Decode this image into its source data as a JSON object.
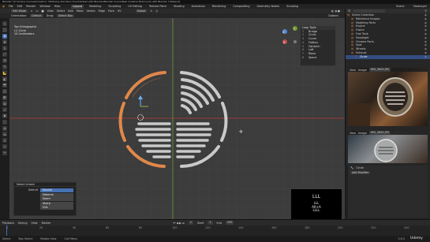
{
  "window_title": "Blender* [D:\\Online Courses\\Creators' 3D\\Harley-Davidson Knucklehead with Blender\\Blender Scene\\Real Creative Motorcycle with Blender 3.6\\blend]",
  "menu": [
    "File",
    "Edit",
    "Render",
    "Window",
    "Help"
  ],
  "workspace_tabs": [
    "Layout",
    "Modeling",
    "Sculpting",
    "UV Editing",
    "Texture Paint",
    "Shading",
    "Animation",
    "Rendering",
    "Compositing",
    "Geometry Nodes",
    "Scripting"
  ],
  "active_tab": "Layout",
  "scene_label": "Scene",
  "view_layer_label": "ViewLayer",
  "header": {
    "mode": "Edit Mode",
    "menus": [
      "View",
      "Select",
      "Add",
      "Mesh",
      "Vertex",
      "Edge",
      "Face",
      "UV"
    ],
    "transform": "Global",
    "orientation_label": "Orientation:",
    "orientation_value": "Default",
    "drag_label": "Drag:",
    "drag_value": "Select Box",
    "options_label": "Options"
  },
  "viewport_info": {
    "line1": "Top Orthographic",
    "line2": "(1) Circle",
    "line3": "10 Centimeters"
  },
  "last_operator": {
    "title": "Select Linked",
    "delimit_label": "Delimit",
    "options": [
      "Normal",
      "Material",
      "Seam",
      "Sharp",
      "UVs"
    ],
    "selected": "Normal"
  },
  "view_list": {
    "title": "Loop Tools",
    "rows": [
      {
        "n": "1",
        "l": "Bridge"
      },
      {
        "n": "2",
        "l": "Circle"
      },
      {
        "n": "3",
        "l": "Curve"
      },
      {
        "n": "4",
        "l": "Flatten"
      },
      {
        "n": "5",
        "l": "Gstretch"
      },
      {
        "n": "6",
        "l": "Loft"
      },
      {
        "n": "7",
        "l": "Relax"
      },
      {
        "n": "8",
        "l": "Space"
      }
    ]
  },
  "shortcut_overlay": {
    "big": "LLL",
    "line1": "LLL",
    "line2": "Alt+A",
    "line3": "LLLL"
  },
  "outliner": {
    "search_placeholder": "",
    "items": [
      {
        "label": "Scene Collection",
        "indent": 0,
        "sel": false
      },
      {
        "label": "Reference Images",
        "indent": 1,
        "sel": false
      },
      {
        "label": "Modeling Parts",
        "indent": 1,
        "sel": false
      },
      {
        "label": "Engine",
        "indent": 1,
        "sel": false
      },
      {
        "label": "Frame",
        "indent": 1,
        "sel": false
      },
      {
        "label": "Fuel Tank",
        "indent": 1,
        "sel": false
      },
      {
        "label": "Headlight",
        "indent": 1,
        "sel": false
      },
      {
        "label": "Chrome Parts",
        "indent": 1,
        "sel": false
      },
      {
        "label": "Seat",
        "indent": 1,
        "sel": false
      },
      {
        "label": "Wheels",
        "indent": 1,
        "sel": false
      },
      {
        "label": "Exhaust",
        "indent": 1,
        "sel": false
      },
      {
        "label": "Circle",
        "indent": 2,
        "sel": true
      }
    ]
  },
  "image_editors": [
    {
      "view": "View",
      "image": "Image",
      "name": "IMG_3843.JPG"
    },
    {
      "view": "View",
      "image": "Image",
      "name": "IMG_3845.JPG"
    }
  ],
  "properties": {
    "object_name": "Circle",
    "modifier_label": "Add Modifier"
  },
  "timeline": {
    "menus": [
      "Playback",
      "Keying",
      "View",
      "Marker"
    ],
    "current_frame": "1",
    "start_label": "Start",
    "start": "1",
    "end_label": "End",
    "end": "250",
    "ticks": [
      "0",
      "20",
      "40",
      "60",
      "80",
      "100",
      "120",
      "140",
      "160",
      "180",
      "200",
      "220",
      "240"
    ]
  },
  "status": {
    "select": "Select",
    "box": "Box Select",
    "rotate": "Rotate View",
    "call_menu": "Call Menu",
    "version": "3.6.5"
  },
  "watermark": "Udemy",
  "colors": {
    "accent": "#4772b3",
    "selected_edge": "#e0884a",
    "mesh": "#c9c9c9",
    "x_axis": "#b23d3d",
    "y_axis": "#6f9a2f"
  }
}
